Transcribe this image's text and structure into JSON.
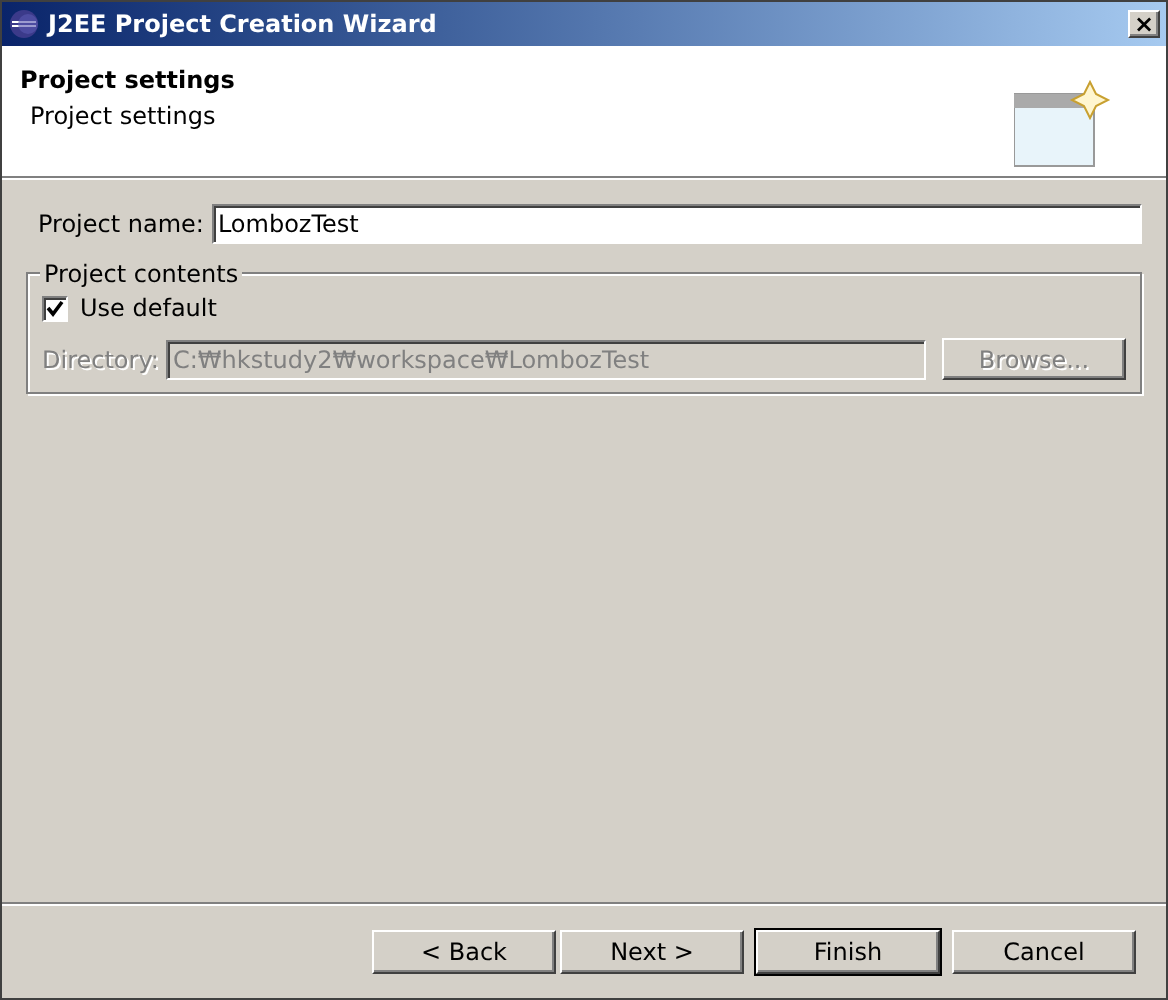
{
  "window": {
    "title": "J2EE Project Creation Wizard",
    "close": "×"
  },
  "header": {
    "title": "Project settings",
    "description": "Project settings"
  },
  "project_name": {
    "label": "Project name:",
    "value": "LombozTest"
  },
  "project_contents": {
    "legend": "Project contents",
    "use_default": {
      "label": "Use default",
      "checked": true
    },
    "directory": {
      "label": "Directory:",
      "value": "C:₩hkstudy2₩workspace₩LombozTest",
      "disabled": true
    },
    "browse": {
      "label": "Browse...",
      "disabled": true
    }
  },
  "buttons": [
    {
      "label": "< Back",
      "default": false
    },
    {
      "label": "Next >",
      "default": false
    },
    {
      "label": "Finish",
      "default": true
    },
    {
      "label": "Cancel",
      "default": false
    }
  ]
}
